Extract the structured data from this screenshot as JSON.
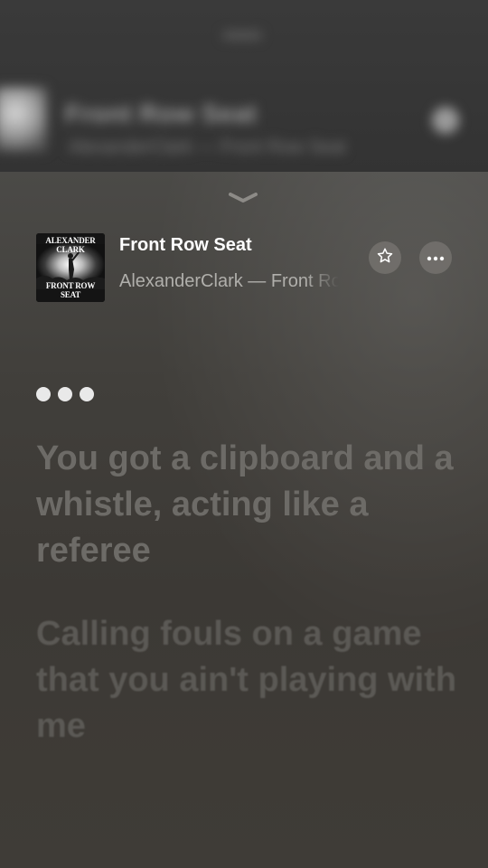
{
  "background_screen": {
    "title": "Front Row Seat",
    "subtitle": "AlexanderClark — Front Row Seat"
  },
  "now_playing": {
    "artwork": {
      "top_text": "ALEXANDER CLARK",
      "bottom_text": "FRONT ROW SEAT"
    },
    "title": "Front Row Seat",
    "subtitle": "AlexanderClark — Front Row Seat",
    "icons": {
      "collapse": "chevron-down-icon",
      "favorite": "star-icon",
      "more": "ellipsis-icon"
    }
  },
  "lyrics": {
    "lines": [
      "You got a clipboard and a whistle, acting like a referee",
      "Calling fouls on a game that you ain't playing with me",
      ""
    ]
  },
  "colors": {
    "background": "#3f3c37",
    "lyric_inactive": "#6d6b67",
    "text_primary": "#ffffff",
    "text_secondary": "#b0afab"
  }
}
